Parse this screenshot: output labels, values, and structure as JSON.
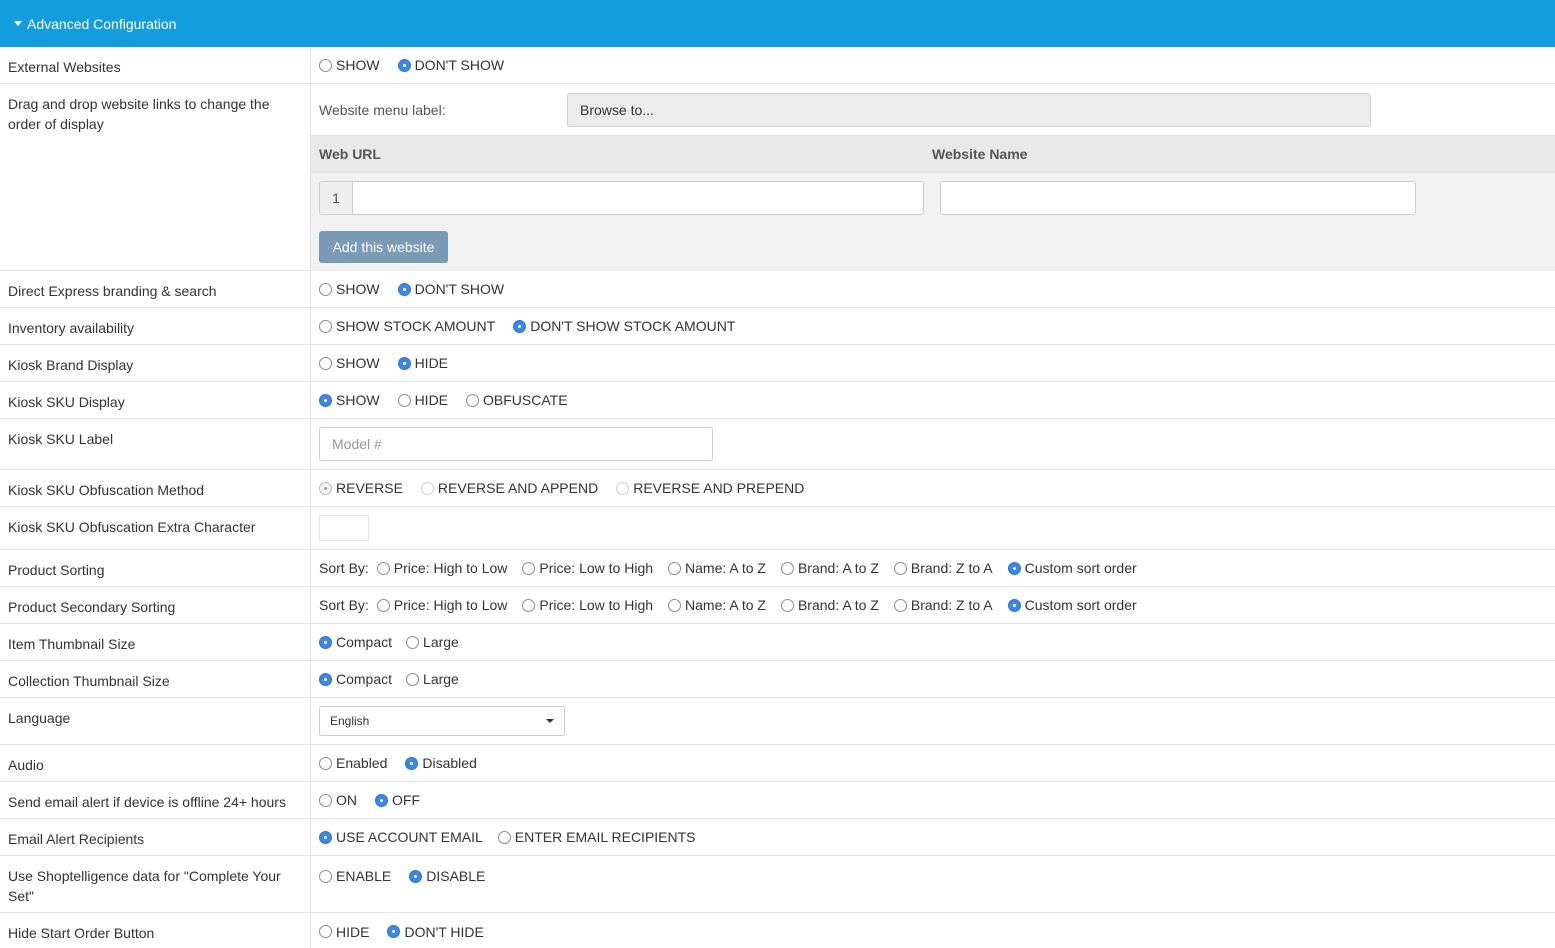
{
  "header": {
    "title": "Advanced Configuration"
  },
  "rows": {
    "external_websites": {
      "label": "External Websites",
      "options": [
        "SHOW",
        "DON'T SHOW"
      ]
    },
    "drag_drop": {
      "label": "Drag and drop website links to change the order of display",
      "menu_label": "Website menu label:",
      "browse_placeholder": "Browse to...",
      "col_url": "Web URL",
      "col_name": "Website Name",
      "row_number": "1",
      "add_button": "Add this website"
    },
    "direct_express": {
      "label": "Direct Express branding & search",
      "options": [
        "SHOW",
        "DON'T SHOW"
      ]
    },
    "inventory": {
      "label": "Inventory availability",
      "options": [
        "SHOW STOCK AMOUNT",
        "DON'T SHOW STOCK AMOUNT"
      ]
    },
    "kiosk_brand": {
      "label": "Kiosk Brand Display",
      "options": [
        "SHOW",
        "HIDE"
      ]
    },
    "kiosk_sku_display": {
      "label": "Kiosk SKU Display",
      "options": [
        "SHOW",
        "HIDE",
        "OBFUSCATE"
      ]
    },
    "kiosk_sku_label": {
      "label": "Kiosk SKU Label",
      "placeholder": "Model #"
    },
    "kiosk_sku_method": {
      "label": "Kiosk SKU Obfuscation Method",
      "options": [
        "REVERSE",
        "REVERSE AND APPEND",
        "REVERSE AND PREPEND"
      ]
    },
    "kiosk_sku_extra": {
      "label": "Kiosk SKU Obfuscation Extra Character"
    },
    "product_sorting": {
      "label": "Product Sorting",
      "sort_by": "Sort By:",
      "options": [
        "Price: High to Low",
        "Price: Low to High",
        "Name: A to Z",
        "Brand: A to Z",
        "Brand: Z to A",
        "Custom sort order"
      ]
    },
    "product_secondary_sorting": {
      "label": "Product Secondary Sorting",
      "sort_by": "Sort By:",
      "options": [
        "Price: High to Low",
        "Price: Low to High",
        "Name: A to Z",
        "Brand: A to Z",
        "Brand: Z to A",
        "Custom sort order"
      ]
    },
    "item_thumb": {
      "label": "Item Thumbnail Size",
      "options": [
        "Compact",
        "Large"
      ]
    },
    "collection_thumb": {
      "label": "Collection Thumbnail Size",
      "options": [
        "Compact",
        "Large"
      ]
    },
    "language": {
      "label": "Language",
      "selected": "English"
    },
    "audio": {
      "label": "Audio",
      "options": [
        "Enabled",
        "Disabled"
      ]
    },
    "offline_alert": {
      "label": "Send email alert if device is offline 24+ hours",
      "options": [
        "ON",
        "OFF"
      ]
    },
    "email_recipients": {
      "label": "Email Alert Recipients",
      "options": [
        "USE ACCOUNT EMAIL",
        "ENTER EMAIL RECIPIENTS"
      ]
    },
    "shoptelligence": {
      "label": "Use Shoptelligence data for \"Complete Your Set\"",
      "options": [
        "ENABLE",
        "DISABLE"
      ]
    },
    "hide_start": {
      "label": "Hide Start Order Button",
      "options": [
        "HIDE",
        "DON'T HIDE"
      ]
    }
  },
  "colors": {
    "header_bg": "#149ddd",
    "radio_selected": "#3b86e6",
    "add_button_bg": "#7a9ab5"
  }
}
